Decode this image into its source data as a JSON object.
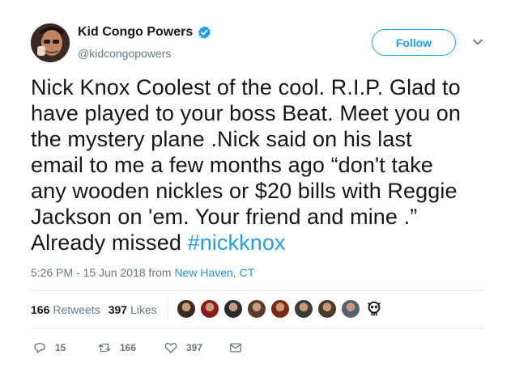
{
  "user": {
    "name": "Kid Congo Powers",
    "handle": "@kidcongopowers",
    "verified": true
  },
  "follow_label": "Follow",
  "tweet": {
    "lines": [
      "Nick Knox Coolest of the cool. R.I.P. Glad to",
      "have played to your boss Beat. Meet you on",
      "the mystery plane .Nick said on his last",
      "email to me a few months ago “don't take",
      "any wooden nickles or $20 bills with Reggie",
      "Jackson on 'em. Your friend and mine .”"
    ],
    "last_line_prefix": "Already missed ",
    "hashtag": "#nickknox"
  },
  "meta": {
    "time": "5:26 PM - 15 Jun 2018",
    "from": " from ",
    "location": "New Haven, CT"
  },
  "stats": {
    "retweets_count": "166",
    "retweets_label": "Retweets",
    "likes_count": "397",
    "likes_label": "Likes"
  },
  "liker_faces": [
    "#3a2a22",
    "#8b1a1a",
    "#2b2b2b",
    "#5a3a28",
    "#7a2a10",
    "#3b3b3b",
    "#4a3a2a",
    "#556070",
    "#1a1a1a"
  ],
  "actions": {
    "reply_count": "15",
    "retweet_count": "166",
    "like_count": "397"
  },
  "colors": {
    "accent": "#1da1f2",
    "secondary_text": "#657786",
    "primary_text": "#14171a"
  }
}
